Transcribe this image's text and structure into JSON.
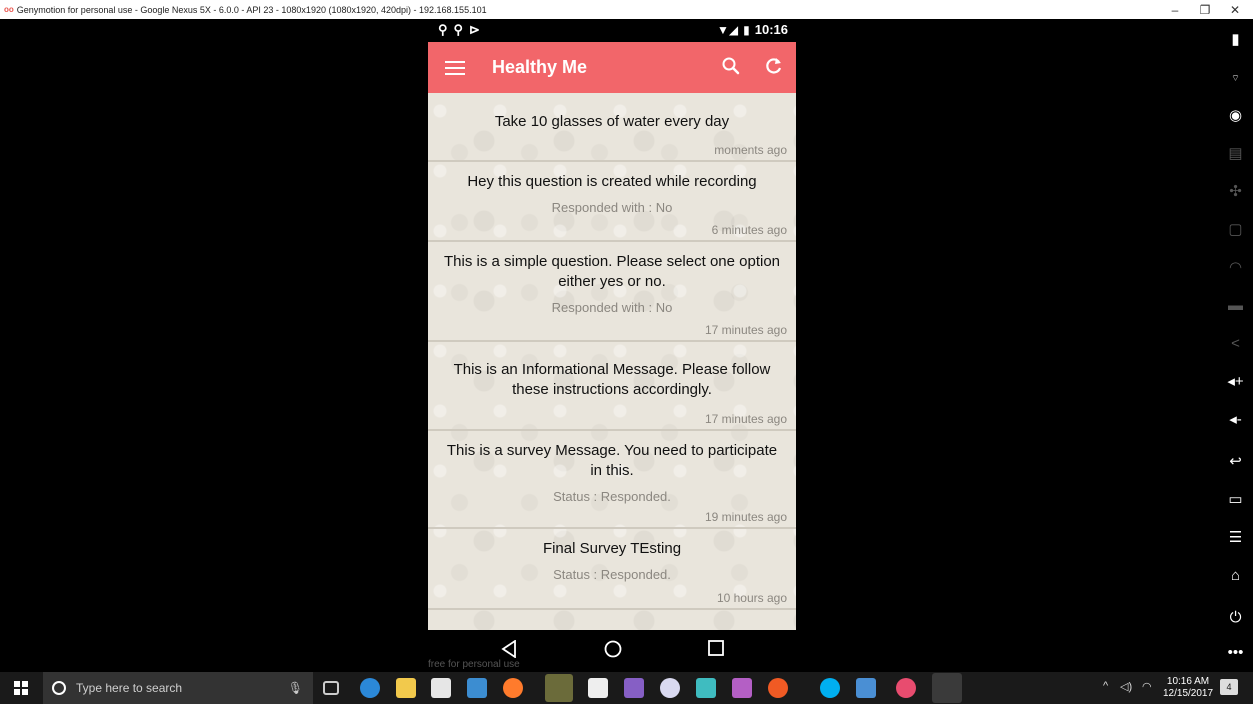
{
  "window": {
    "title": "Genymotion for personal use - Google Nexus 5X - 6.0.0 - API 23 - 1080x1920 (1080x1920, 420dpi) - 192.168.155.101",
    "minimize": "–",
    "restore": "❐",
    "close": "✕"
  },
  "phone": {
    "status": {
      "left_icons": "⚲⚲⊳",
      "signal": "▼◢",
      "battery": "▮",
      "time": "10:16"
    },
    "app": {
      "title": "Healthy Me"
    },
    "messages": [
      {
        "text": "Take 10 glasses of water every day",
        "response": "",
        "time": "moments ago"
      },
      {
        "text": "Hey this question is created while recording",
        "response": "Responded with : No",
        "time": "6 minutes ago"
      },
      {
        "text": "This is a simple question. Please select one option either yes or no.",
        "response": "Responded with : No",
        "time": "17 minutes ago"
      },
      {
        "text": "This is an Informational Message. Please follow these instructions accordingly.",
        "response": "",
        "time": "17 minutes ago"
      },
      {
        "text": "This is a survey Message. You need to participate in this.",
        "response": "Status : Responded.",
        "time": "19 minutes ago"
      },
      {
        "text": "Final Survey TEsting",
        "response": "Status : Responded.",
        "time": "10 hours ago"
      }
    ]
  },
  "watermark": "free for personal use",
  "taskbar": {
    "search_placeholder": "Type here to search",
    "clock_time": "10:16 AM",
    "clock_date": "12/15/2017",
    "notification_count": "4"
  },
  "colors": {
    "accent": "#f2666a",
    "background": "#000000",
    "card": "#e9e5dc"
  }
}
